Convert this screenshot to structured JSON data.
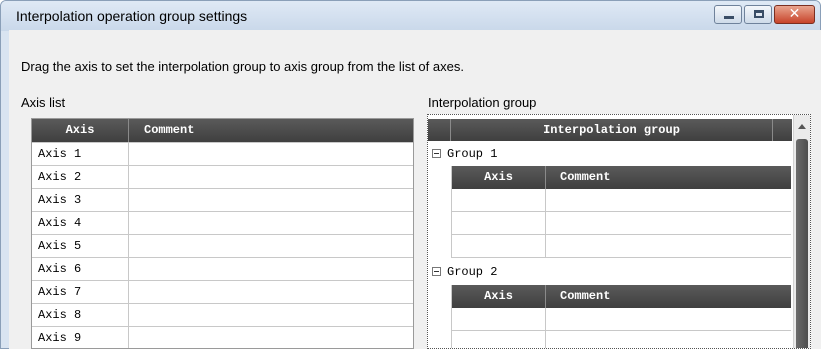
{
  "window": {
    "title": "Interpolation operation group settings",
    "controls": {
      "minimize": "minimize",
      "maximize": "maximize",
      "close": "✕"
    }
  },
  "instruction": "Drag the axis to set the interpolation group to axis group from the list of axes.",
  "axis_list": {
    "label": "Axis list",
    "columns": [
      "Axis",
      "Comment"
    ],
    "rows": [
      {
        "axis": "Axis 1",
        "comment": ""
      },
      {
        "axis": "Axis 2",
        "comment": ""
      },
      {
        "axis": "Axis 3",
        "comment": ""
      },
      {
        "axis": "Axis 4",
        "comment": ""
      },
      {
        "axis": "Axis 5",
        "comment": ""
      },
      {
        "axis": "Axis 6",
        "comment": ""
      },
      {
        "axis": "Axis 7",
        "comment": ""
      },
      {
        "axis": "Axis 8",
        "comment": ""
      },
      {
        "axis": "Axis 9",
        "comment": ""
      }
    ]
  },
  "interpolation_group": {
    "label": "Interpolation group",
    "header": "Interpolation group",
    "groups": [
      {
        "name": "Group 1",
        "columns": [
          "Axis",
          "Comment"
        ]
      },
      {
        "name": "Group 2",
        "columns": [
          "Axis",
          "Comment"
        ]
      }
    ]
  },
  "colors": {
    "header_bg": "#4a4a4a",
    "window_bg": "#f0f0f0",
    "close_button": "#c7432a"
  },
  "icons": {
    "collapse": "minus-box-icon",
    "scroll_up": "triangle-up-icon"
  }
}
